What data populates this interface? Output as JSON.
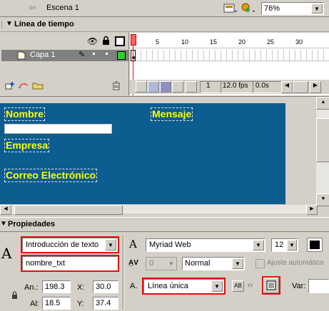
{
  "scene": {
    "name": "Escena 1",
    "zoom": "76%"
  },
  "timeline": {
    "title": "Línea de tiempo",
    "frame_numbers": [
      "1",
      "5",
      "10",
      "15",
      "20",
      "25",
      "30"
    ],
    "layer_name": "Capa 1",
    "current_frame": "1",
    "fps": "12.0 fps",
    "time": "0.0s"
  },
  "stage": {
    "labels": [
      "Nombre",
      "Mensaje",
      "Empresa",
      "Correo Electrónico"
    ],
    "bg_color": "#0c5d90",
    "text_color": "#ffff00"
  },
  "properties": {
    "title": "Propiedades",
    "text_type": "Introducción de texto",
    "instance_name": "nombre_txt",
    "font": "Myriad Web",
    "font_size": "12",
    "letter_spacing": "0",
    "position_mode": "Normal",
    "auto_kern": "Ajuste automático",
    "line_type": "Línea única",
    "var_label": "Var:",
    "w_label": "An.:",
    "w_value": "198.3",
    "x_label": "X:",
    "x_value": "30.0",
    "h_label": "Al:",
    "h_value": "18.5",
    "y_label": "Y:",
    "y_value": "37.4"
  }
}
